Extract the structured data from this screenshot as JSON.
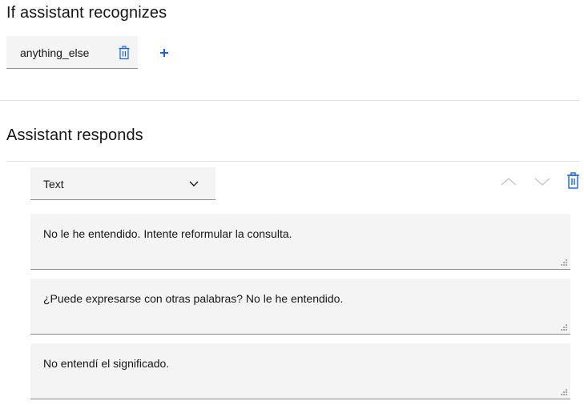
{
  "recognizes": {
    "title": "If assistant recognizes",
    "condition_label": "anything_else",
    "trash_icon": "trash-icon",
    "add_icon": "plus-icon"
  },
  "responds": {
    "title": "Assistant responds",
    "response_type": "Text",
    "dropdown_icon": "chevron-down-icon",
    "controls": [
      "chevron-up-icon",
      "chevron-down-icon",
      "trash-icon"
    ],
    "variations": [
      "No le he entendido. Intente reformular la consulta.",
      "¿Puede expresarse con otras palabras? No le he entendido.",
      "No entendí el significado."
    ]
  },
  "colors": {
    "accent": "#0f62fe",
    "field_bg": "#f4f4f4",
    "divider": "#e0e0e0",
    "disabled": "#c6c6c6"
  }
}
